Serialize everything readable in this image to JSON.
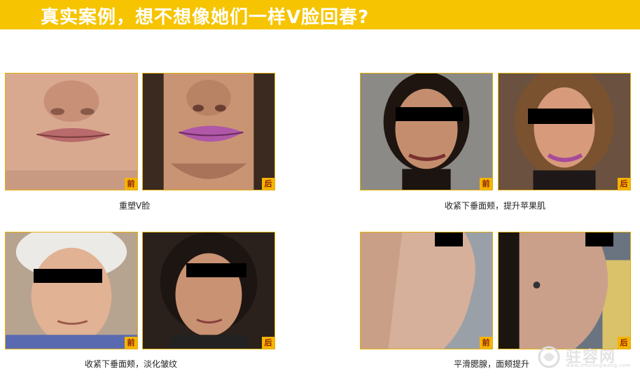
{
  "banner": {
    "title": "真实案例，想不想像她们一样V脸回春?",
    "color": "#f6c400"
  },
  "labels": {
    "before": "前",
    "after": "后"
  },
  "cases": [
    {
      "caption": "重塑V脸"
    },
    {
      "caption": "收紧下垂面颊，提升苹果肌"
    },
    {
      "caption": "收紧下垂面颊，淡化皱纹"
    },
    {
      "caption": "平滑腮腺，面颊提升"
    }
  ],
  "watermark": {
    "text": "驻容网",
    "url": "www.zhurongwang.com"
  }
}
